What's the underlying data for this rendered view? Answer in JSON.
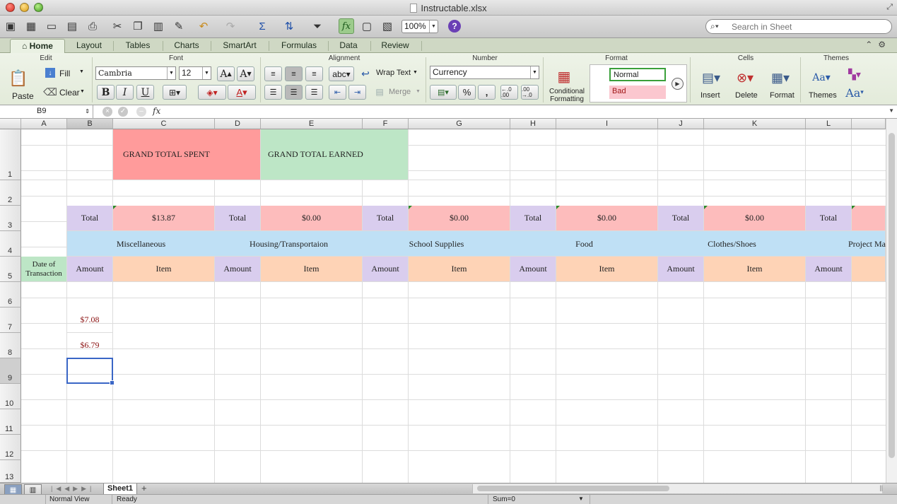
{
  "window": {
    "title": "Instructable.xlsx"
  },
  "toolbar": {
    "zoom": "100%",
    "search_placeholder": "Search in Sheet"
  },
  "ribbon_tabs": [
    "Home",
    "Layout",
    "Tables",
    "Charts",
    "SmartArt",
    "Formulas",
    "Data",
    "Review"
  ],
  "ribbon": {
    "groups": {
      "edit": "Edit",
      "font": "Font",
      "alignment": "Alignment",
      "number": "Number",
      "format": "Format",
      "cells": "Cells",
      "themes": "Themes"
    },
    "paste": "Paste",
    "fill": "Fill",
    "clear": "Clear",
    "font_name": "Cambria",
    "font_size": "12",
    "bold": "B",
    "italic": "I",
    "underline": "U",
    "font_color_glyph": "A",
    "grow_font": "A",
    "shrink_font": "A",
    "orient_glyph": "abc",
    "wrap_text": "Wrap Text",
    "merge": "Merge",
    "number_format": "Currency",
    "percent": "%",
    "comma": ",",
    "increase_decimal": "←.0 .00",
    "decrease_decimal": ".00 →.0",
    "conditional_formatting": [
      "Conditional",
      "Formatting"
    ],
    "style_normal": "Normal",
    "style_bad": "Bad",
    "insert": "Insert",
    "delete": "Delete",
    "format": "Format",
    "themes": "Themes",
    "theme_fonts_glyph": "Aa"
  },
  "formula_bar": {
    "cell_ref": "B9",
    "fx": "fx",
    "value": ""
  },
  "columns": [
    "A",
    "B",
    "C",
    "D",
    "E",
    "F",
    "G",
    "H",
    "I",
    "J",
    "K",
    "L"
  ],
  "rows": [
    "1",
    "2",
    "3",
    "4",
    "5",
    "6",
    "7",
    "8",
    "9",
    "10",
    "11",
    "12",
    "13"
  ],
  "cells": {
    "grand_total_spent": "GRAND TOTAL SPENT",
    "grand_total_earned": "GRAND TOTAL EARNED",
    "total_label": "Total",
    "totals": [
      "$13.87",
      "$0.00",
      "$0.00",
      "$0.00",
      "$0.00"
    ],
    "categories": [
      "Miscellaneous",
      "Housing/Transportaion",
      "School Supplies",
      "Food",
      "Clothes/Shoes",
      "Project Ma"
    ],
    "date_of_transaction": "Date of Transaction",
    "amount": "Amount",
    "item": "Item",
    "b7": "$7.08",
    "b8": "$6.79"
  },
  "sheet_tabs": {
    "active": "Sheet1",
    "add": "+"
  },
  "status": {
    "view": "Normal View",
    "state": "Ready",
    "sum": "Sum=0"
  },
  "colors": {
    "accent_green": "#9ccb8c",
    "grand_spent": "#ff9b9b",
    "grand_earned": "#bde6c6",
    "total_value": "#fdbcbc",
    "total_label": "#d9cdee",
    "category": "#bfe0f5",
    "item_header": "#fed3b6",
    "selection": "#3a66c6"
  }
}
